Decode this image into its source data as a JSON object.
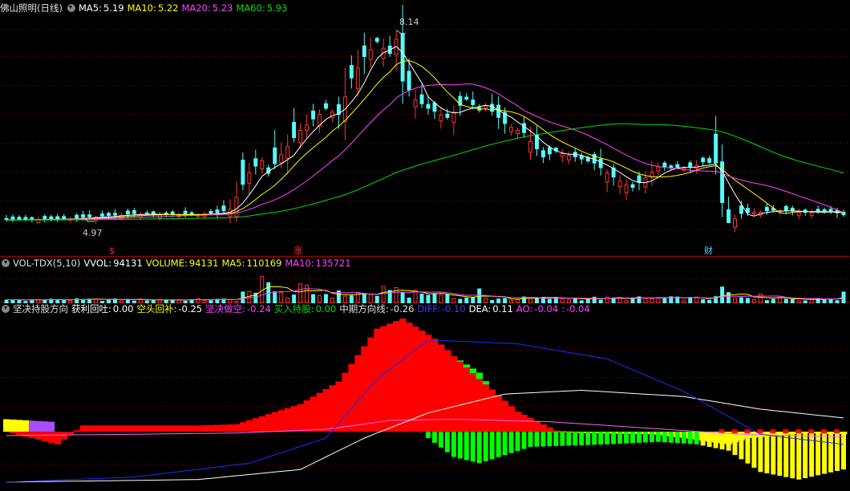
{
  "colors": {
    "up": "#ff3232",
    "down": "#54fcfc",
    "ma5": "#ffffff",
    "ma10": "#ffff00",
    "ma20": "#ff44ff",
    "ma60": "#00e000",
    "grid": "#8b0000",
    "strong": "#ff0000",
    "green": "#00ff00",
    "yellow": "#ffff00",
    "violet": "#a64dff",
    "diff": "#2828ff",
    "dea": "#ffffff",
    "ao": "#ff60ff"
  },
  "price_panel": {
    "title": "佛山照明(日线)",
    "ma5_label": "MA5:",
    "ma5_value": "5.19",
    "ma10_label": "MA10:",
    "ma10_value": "5.22",
    "ma20_label": "MA20:",
    "ma20_value": "5.23",
    "ma60_label": "MA60:",
    "ma60_value": "5.93",
    "high_mark": "8.14",
    "low_mark": "4.97",
    "tag_1": "$",
    "tag_2": "涨",
    "tag_3": "财"
  },
  "volume_panel": {
    "title": "VOL-TDX(5,10)",
    "vvol_label": "VVOL:",
    "vvol_value": "94131",
    "volume_label": "VOLUME:",
    "volume_value": "94131",
    "ma5_label": "MA5:",
    "ma5_value": "110169",
    "ma10_label": "MA10:",
    "ma10_value": "135721"
  },
  "indicator_panel": {
    "title": "坚决持股方向",
    "i1_label": "获利回吐:",
    "i1_value": "0.00",
    "i2_label": "空头回补:",
    "i2_value": "-0.25",
    "i3_label": "坚决做空:",
    "i3_value": "-0.24",
    "i4_label": "买入持股:",
    "i4_value": "0.00",
    "i5_label": "中期方向线:",
    "i5_value": "-0.26",
    "i6_label": "DIFF:",
    "i6_value": "-0.10",
    "i7_label": "DEA:",
    "i7_value": "0.11",
    "i8_label": "AO:",
    "i8_value": "-0.04",
    "i9_label": ":",
    "i9_value": "-0.04"
  },
  "chart_data": {
    "type": "candlestick",
    "price_axis": {
      "min": 4.6,
      "max": 8.4
    },
    "anchors_close": [
      [
        0,
        5.02
      ],
      [
        10,
        5.04
      ],
      [
        20,
        5.12
      ],
      [
        27,
        5.1
      ],
      [
        33,
        5.13
      ],
      [
        35,
        5.2
      ],
      [
        38,
        5.8
      ],
      [
        40,
        6.0
      ],
      [
        41,
        5.78
      ],
      [
        43,
        6.1
      ],
      [
        46,
        6.5
      ],
      [
        50,
        6.85
      ],
      [
        52,
        6.75
      ],
      [
        54,
        7.35
      ],
      [
        56,
        7.7
      ],
      [
        58,
        7.95
      ],
      [
        60,
        7.75
      ],
      [
        61,
        8.0
      ],
      [
        62,
        7.3
      ],
      [
        64,
        7.0
      ],
      [
        66,
        6.85
      ],
      [
        69,
        6.7
      ],
      [
        72,
        7.0
      ],
      [
        74,
        6.82
      ],
      [
        75,
        6.9
      ],
      [
        78,
        6.6
      ],
      [
        81,
        6.45
      ],
      [
        84,
        6.05
      ],
      [
        86,
        6.15
      ],
      [
        89,
        6.05
      ],
      [
        92,
        5.95
      ],
      [
        95,
        5.72
      ],
      [
        98,
        5.55
      ],
      [
        100,
        5.72
      ],
      [
        102,
        5.9
      ],
      [
        104,
        5.88
      ],
      [
        107,
        5.88
      ],
      [
        109,
        5.97
      ],
      [
        111,
        5.95
      ],
      [
        112,
        5.3
      ],
      [
        113,
        4.97
      ],
      [
        115,
        5.12
      ],
      [
        117,
        5.15
      ],
      [
        121,
        5.18
      ],
      [
        125,
        5.14
      ],
      [
        129,
        5.16
      ],
      [
        131,
        5.1
      ]
    ],
    "up_days": [
      5,
      10,
      14,
      18,
      21,
      24,
      27,
      30,
      31,
      35,
      36,
      38,
      40,
      43,
      44,
      46,
      47,
      49,
      51,
      53,
      55,
      57,
      59,
      61,
      64,
      68,
      70,
      75,
      79,
      80,
      82,
      87,
      88,
      94,
      96,
      97,
      100,
      101,
      102,
      106,
      108,
      114,
      117,
      118,
      121,
      124,
      126
    ],
    "volume_axis": {
      "max": 260000
    },
    "volume_spikes": [
      [
        40,
        220000
      ],
      [
        41,
        170000
      ],
      [
        46,
        160000
      ],
      [
        47,
        150000
      ],
      [
        59,
        140000
      ],
      [
        61,
        130000
      ],
      [
        74,
        120000
      ],
      [
        112,
        135000
      ],
      [
        113,
        90000
      ],
      [
        118,
        80000
      ]
    ],
    "indicator_axis": {
      "min": -0.42,
      "max": 0.92
    },
    "diff_anchors": [
      [
        0,
        -0.4
      ],
      [
        20,
        -0.36
      ],
      [
        38,
        -0.25
      ],
      [
        50,
        -0.05
      ],
      [
        58,
        0.42
      ],
      [
        66,
        0.73
      ],
      [
        80,
        0.7
      ],
      [
        94,
        0.58
      ],
      [
        106,
        0.32
      ],
      [
        118,
        -0.02
      ],
      [
        131,
        -0.1
      ]
    ],
    "dea_anchors": [
      [
        0,
        -0.4
      ],
      [
        30,
        -0.38
      ],
      [
        46,
        -0.3
      ],
      [
        56,
        -0.05
      ],
      [
        66,
        0.15
      ],
      [
        78,
        0.3
      ],
      [
        90,
        0.33
      ],
      [
        106,
        0.28
      ],
      [
        118,
        0.18
      ],
      [
        131,
        0.11
      ]
    ],
    "ao_anchors": [
      [
        0,
        -0.03
      ],
      [
        20,
        -0.02
      ],
      [
        36,
        -0.01
      ],
      [
        50,
        0.02
      ],
      [
        60,
        0.09
      ],
      [
        70,
        0.1
      ],
      [
        85,
        0.08
      ],
      [
        100,
        0.03
      ],
      [
        115,
        -0.02
      ],
      [
        131,
        -0.04
      ]
    ],
    "red_anchors": [
      [
        0,
        0
      ],
      [
        8,
        -0.1
      ],
      [
        12,
        0.05
      ],
      [
        30,
        0.05
      ],
      [
        36,
        0.06
      ],
      [
        46,
        0.22
      ],
      [
        52,
        0.4
      ],
      [
        58,
        0.82
      ],
      [
        62,
        0.9
      ],
      [
        67,
        0.74
      ],
      [
        74,
        0.42
      ],
      [
        80,
        0.16
      ],
      [
        86,
        0.01
      ],
      [
        90,
        0
      ]
    ],
    "green_anchors": [
      [
        66,
        0.76
      ],
      [
        70,
        0.6
      ],
      [
        74,
        0.47
      ],
      [
        78,
        0.2
      ],
      [
        82,
        0.05
      ],
      [
        85,
        0.0
      ]
    ],
    "neg_anchors": [
      [
        0,
        0
      ],
      [
        65,
        0
      ],
      [
        66,
        -0.05
      ],
      [
        70,
        -0.2
      ],
      [
        74,
        -0.25
      ],
      [
        82,
        -0.12
      ],
      [
        94,
        -0.1
      ],
      [
        102,
        -0.08
      ],
      [
        108,
        -0.1
      ],
      [
        113,
        -0.15
      ],
      [
        118,
        -0.32
      ],
      [
        124,
        -0.38
      ],
      [
        131,
        -0.3
      ]
    ],
    "yellow_top": [
      [
        0,
        0.1
      ],
      [
        7,
        0.08
      ],
      [
        8,
        0.03
      ],
      [
        84,
        0
      ],
      [
        90,
        -0.01
      ],
      [
        101,
        -0.02
      ],
      [
        106,
        -0.05
      ],
      [
        110,
        -0.08
      ],
      [
        113,
        -0.1
      ],
      [
        116,
        -0.05
      ],
      [
        125,
        -0.01
      ],
      [
        131,
        -0.02
      ]
    ],
    "n_bars": 132
  }
}
